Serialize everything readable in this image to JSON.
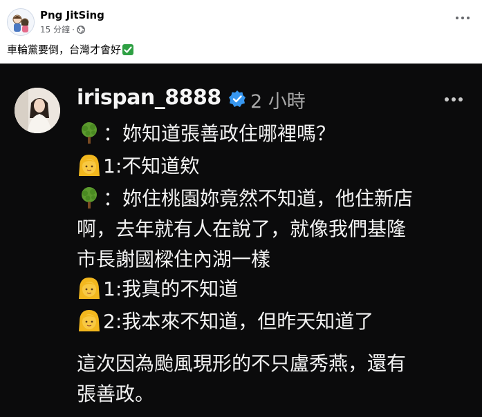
{
  "post": {
    "author": "Png JitSing",
    "time": "15 分鐘",
    "separator": "·",
    "text": "車輪黨要倒，台灣才會好",
    "text_emoji": "check-mark-icon"
  },
  "embedded": {
    "username": "irispan_8888",
    "time": "2 小時",
    "lines": [
      {
        "emoji": "tree-icon",
        "text": "：妳知道張善政住哪裡嗎？"
      },
      {
        "emoji": "woman-icon",
        "text": "1:不知道欸"
      },
      {
        "emoji": "tree-icon",
        "text": "：妳住桃園妳竟然不知道，他住新店"
      },
      {
        "emoji": "",
        "text": "啊，去年就有人在說了，就像我們基隆"
      },
      {
        "emoji": "",
        "text": "市長謝國樑住內湖一樣"
      },
      {
        "emoji": "woman-icon",
        "text": "1:我真的不知道"
      },
      {
        "emoji": "woman-icon",
        "text": "2:我本來不知道，但昨天知道了"
      },
      {
        "emoji": "",
        "text": "這次因為颱風現形的不只盧秀燕，還有"
      },
      {
        "emoji": "",
        "text": "張善政。"
      }
    ]
  },
  "colors": {
    "dark_bg": "#0b0b0c",
    "verified": "#3797f0",
    "check": "#2ea043"
  }
}
